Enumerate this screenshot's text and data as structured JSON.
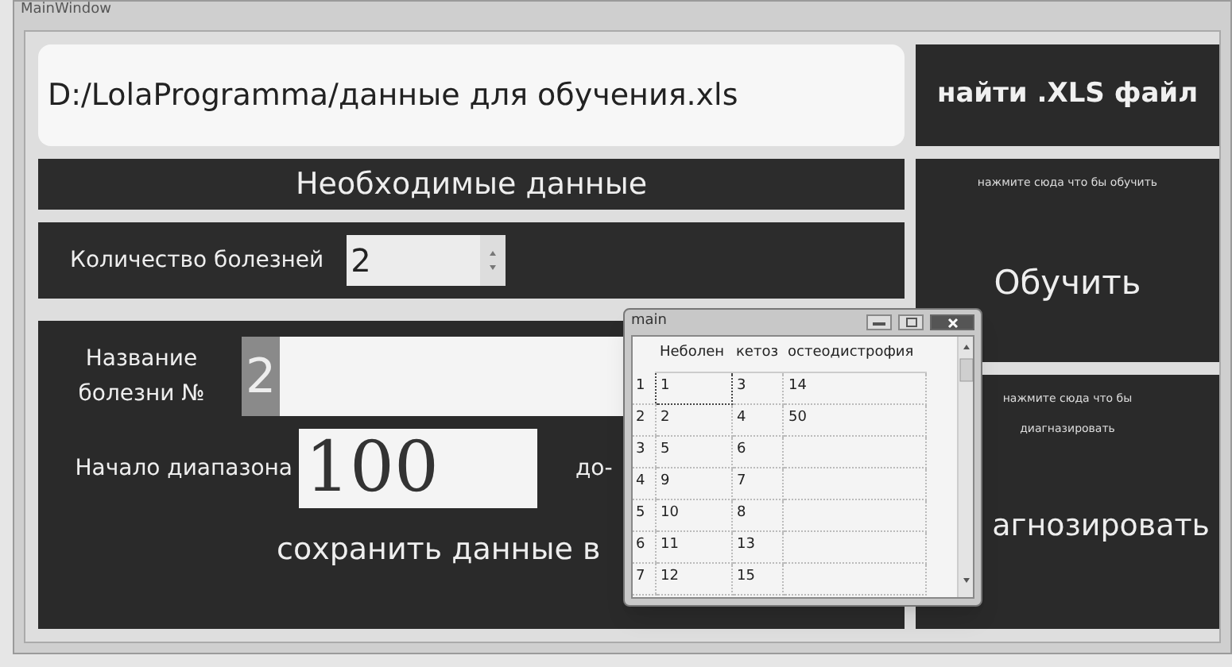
{
  "window": {
    "title": "MainWindow"
  },
  "path_field": {
    "value": "D:/LolaProgramma/данные для обучения.xls"
  },
  "find_button": {
    "label": "найти .XLS файл"
  },
  "section_header": "Необходимые данные",
  "disease_count": {
    "label": "Количество болезней",
    "value": "2"
  },
  "disease_name": {
    "label_line1": "Название",
    "label_line2": "болезни №",
    "number": "2",
    "number_selected": true
  },
  "range": {
    "start_label": "Начало диапазона",
    "start_value": "100",
    "end_label": "до-"
  },
  "save_button": {
    "label": "сохранить данные в"
  },
  "train_panel": {
    "hint": "нажмите сюда что бы обучить",
    "label": "Обучить"
  },
  "diagnose_panel": {
    "hint_line1": "нажмите сюда что бы",
    "hint_line2": "диагназировать",
    "label": "агнозировать"
  },
  "popup": {
    "title": "main",
    "table": {
      "columns": [
        "Неболен",
        "кетоз",
        "остеодистрофия"
      ],
      "rows": [
        {
          "header": "1",
          "cells": [
            "1",
            "3",
            "14"
          ],
          "focused": true
        },
        {
          "header": "2",
          "cells": [
            "2",
            "4",
            "50"
          ],
          "focused": false
        },
        {
          "header": "3",
          "cells": [
            "5",
            "6"
          ],
          "focused": false
        },
        {
          "header": "4",
          "cells": [
            "9",
            "7"
          ],
          "focused": false
        },
        {
          "header": "5",
          "cells": [
            "10",
            "8"
          ],
          "focused": false
        },
        {
          "header": "6",
          "cells": [
            "11",
            "13"
          ],
          "focused": false
        },
        {
          "header": "7",
          "cells": [
            "12",
            "15"
          ],
          "focused": false
        }
      ]
    }
  }
}
